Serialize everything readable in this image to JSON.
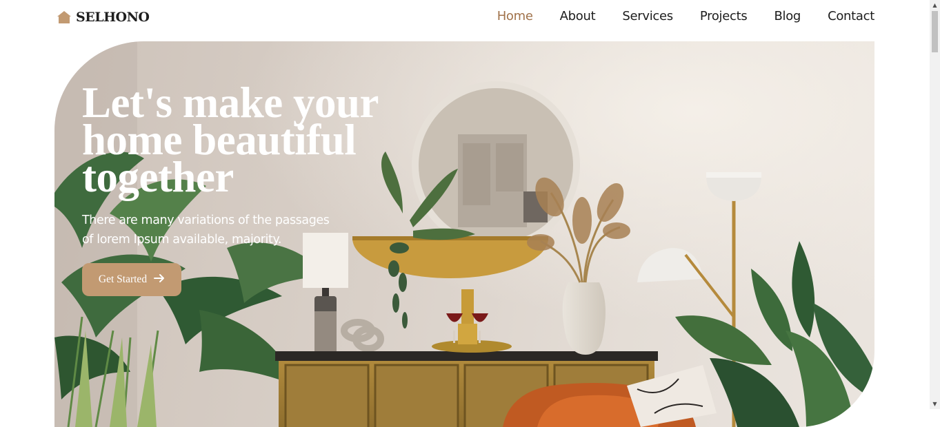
{
  "brand": {
    "name": "SELHONO",
    "icon": "house-icon",
    "color": "#c29a72"
  },
  "nav": {
    "items": [
      {
        "label": "Home",
        "active": true
      },
      {
        "label": "About",
        "active": false
      },
      {
        "label": "Services",
        "active": false
      },
      {
        "label": "Projects",
        "active": false
      },
      {
        "label": "Blog",
        "active": false
      },
      {
        "label": "Contact",
        "active": false
      }
    ],
    "active_color": "#a0724a"
  },
  "hero": {
    "title": "Let's make your home beautiful together",
    "subtitle": "There are many variations of the passages of lorem Ipsum available, majority.",
    "cta_label": "Get Started",
    "cta_icon": "arrow-right-icon",
    "cta_color": "#c29a72"
  }
}
